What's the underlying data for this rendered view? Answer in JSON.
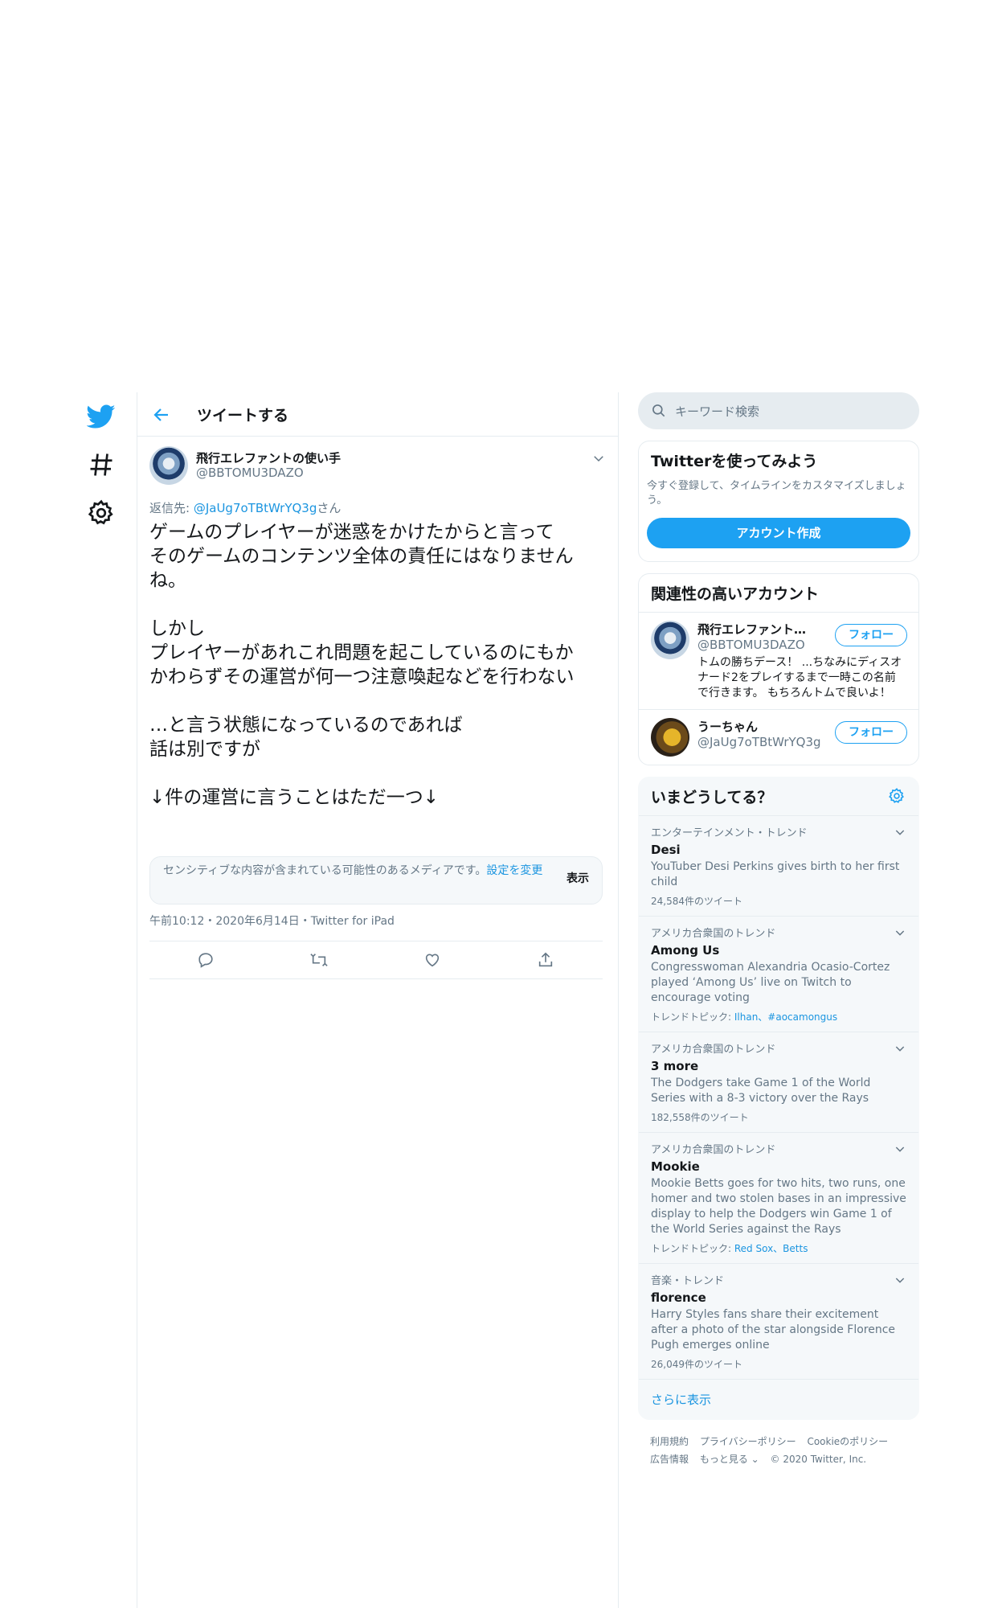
{
  "nav": {
    "items": [
      {
        "icon": "twitter-bird-icon"
      },
      {
        "icon": "hashtag-icon"
      },
      {
        "icon": "gear-icon"
      }
    ]
  },
  "header": {
    "title": "ツイートする"
  },
  "tweet": {
    "name": "飛行エレファントの使い手",
    "handle": "@BBTOMU3DAZO",
    "reply_prefix": "返信先: ",
    "reply_to": "@JaUg7oTBtWrYQ3g",
    "reply_suffix": "さん",
    "text": "ゲームのプレイヤーが迷惑をかけたからと言って\nそのゲームのコンテンツ全体の責任にはなりません\nね。\n\nしかし\nプレイヤーがあれこれ問題を起こしているのにもか\nかわらずその運営が何一つ注意喚起などを行わない\n\n…と言う状態になっているのであれば\n話は別ですが\n\n↓件の運営に言うことはただ一つ↓",
    "sensitive_notice": "センシティブな内容が含まれている可能性のあるメディアです。",
    "sensitive_link": "設定を変更",
    "sensitive_show": "表示",
    "meta": "午前10:12・2020年6月14日・Twitter for iPad"
  },
  "search": {
    "placeholder": "キーワード検索"
  },
  "signup": {
    "title": "Twitterを使ってみよう",
    "desc": "今すぐ登録して、タイムラインをカスタマイズしましょう。",
    "button": "アカウント作成"
  },
  "related": {
    "title": "関連性の高いアカウント",
    "accounts": [
      {
        "name": "飛行エレファントの...",
        "handle": "@BBTOMU3DAZO",
        "bio": "トムの勝ちデース！ ...ちなみにディスオナード2をプレイするまで一時この名前で行きます。 もちろんトムで良いよ！",
        "follow": "フォロー"
      },
      {
        "name": "うーちゃん",
        "handle": "@JaUg7oTBtWrYQ3g",
        "bio": "",
        "follow": "フォロー"
      }
    ]
  },
  "trends": {
    "title": "いまどうしてる？",
    "items": [
      {
        "context": "エンターテインメント・トレンド",
        "name": "Desi",
        "desc": "YouTuber Desi Perkins gives birth to her first child",
        "count": "24,584件のツイート",
        "topics_label": "",
        "topics": ""
      },
      {
        "context": "アメリカ合衆国のトレンド",
        "name": "Among Us",
        "desc": "Congresswoman Alexandria Ocasio-Cortez played ‘Among Us’ live on Twitch to encourage voting",
        "count": "",
        "topics_label": "トレンドトピック: ",
        "topics": "Ilhan、#aocamongus"
      },
      {
        "context": "アメリカ合衆国のトレンド",
        "name": "3 more",
        "desc": "The Dodgers take Game 1 of the World Series with a 8-3 victory over the Rays",
        "count": "182,558件のツイート",
        "topics_label": "",
        "topics": ""
      },
      {
        "context": "アメリカ合衆国のトレンド",
        "name": "Mookie",
        "desc": "Mookie Betts goes for two hits, two runs, one homer and two stolen bases in an impressive display to help the Dodgers win Game 1 of the World Series against the Rays",
        "count": "",
        "topics_label": "トレンドトピック: ",
        "topics": "Red Sox、Betts"
      },
      {
        "context": "音楽・トレンド",
        "name": "florence",
        "desc": "Harry Styles fans share their excitement after a photo of the star alongside Florence Pugh emerges online",
        "count": "26,049件のツイート",
        "topics_label": "",
        "topics": ""
      }
    ],
    "more": "さらに表示"
  },
  "footer": {
    "links": [
      "利用規約",
      "プライバシーポリシー",
      "Cookieのポリシー",
      "広告情報",
      "もっと見る ⌄"
    ],
    "copyright": "© 2020 Twitter, Inc."
  },
  "colors": {
    "accent": "#1da1f2",
    "link": "#1b95e0",
    "muted": "#657786",
    "border": "#e6ecf0"
  }
}
